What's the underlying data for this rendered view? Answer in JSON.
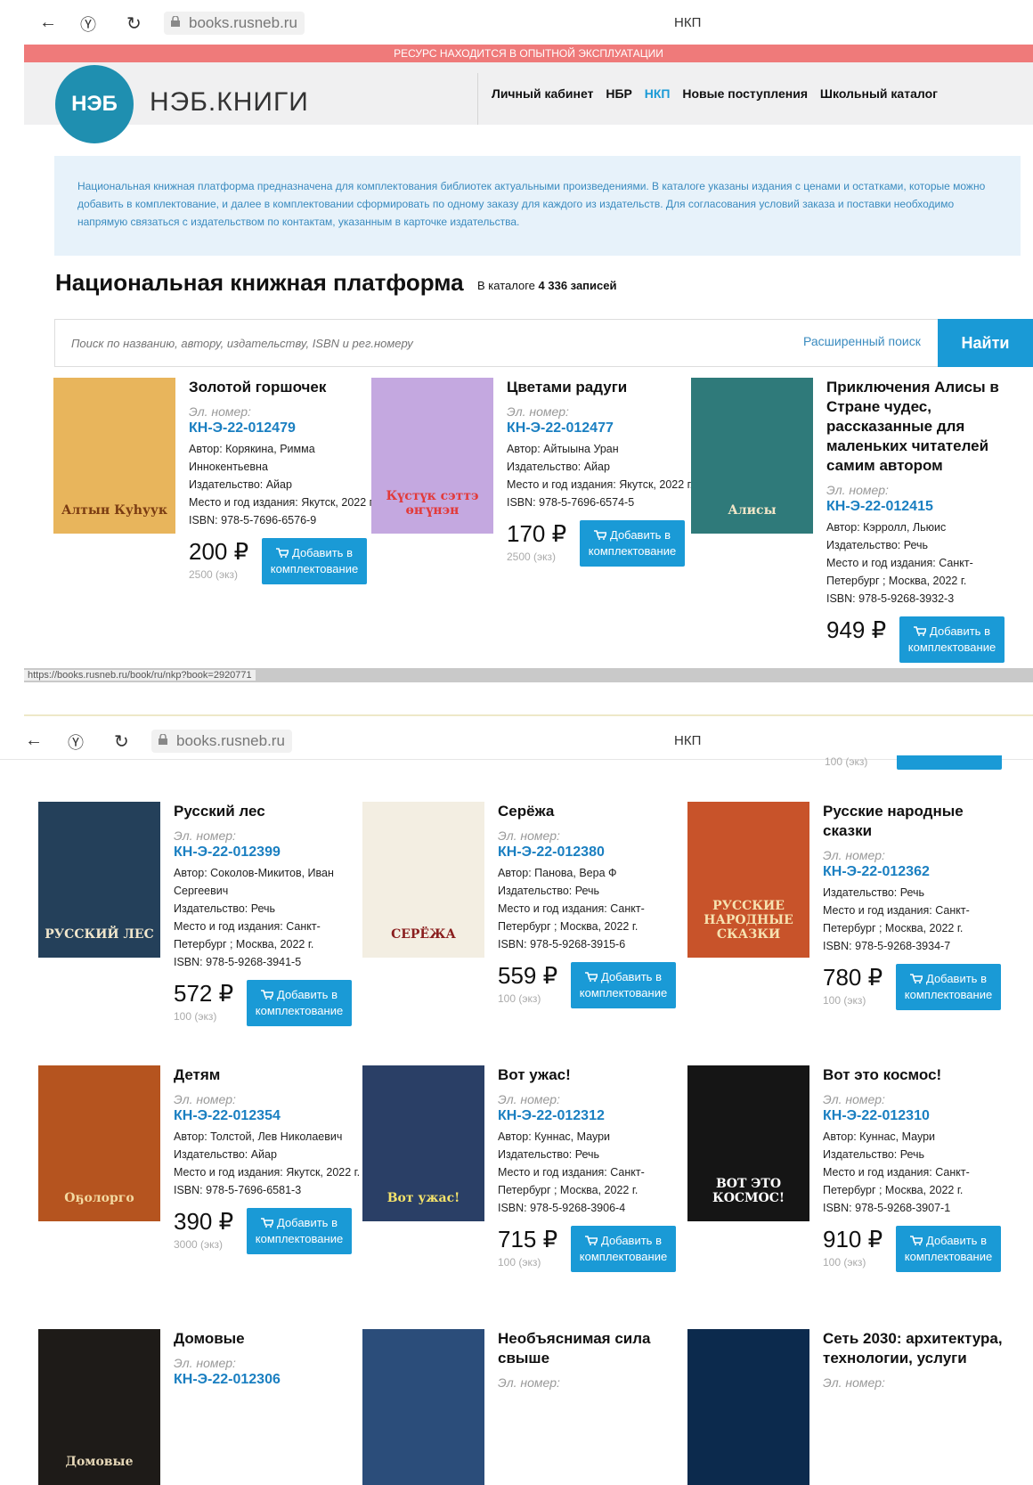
{
  "browser1": {
    "url": "books.rusneb.ru",
    "page_title": "НКП"
  },
  "browser2": {
    "url": "books.rusneb.ru",
    "page_title": "НКП"
  },
  "banner": "РЕСУРС НАХОДИТСЯ В ОПЫТНОЙ ЭКСПЛУАТАЦИИ",
  "logo": {
    "mark": "НЭБ",
    "name": "НЭБ.КНИГИ"
  },
  "menu": [
    "Личный кабинет",
    "НБР",
    "НКП",
    "Новые поступления",
    "Школьный каталог"
  ],
  "info": "Национальная книжная платформа предназначена для комплектования библиотек актуальными произведениями. В каталоге указаны издания с ценами и остатками, которые можно добавить в комплектование, и далее в комплектовании сформировать по одному заказу для каждого из издательств. Для согласования условий заказа и поставки необходимо напрямую связаться с издательством по контактам, указанным в карточке издательства.",
  "heading": "Национальная книжная платформа",
  "count_prefix": "В каталоге",
  "count_value": "4 336 записей",
  "search": {
    "placeholder": "Поиск по названию, автору, издательству, ISBN и рег.номеру",
    "advanced": "Расширенный поиск",
    "button": "Найти"
  },
  "status_url": "https://books.rusneb.ru/book/ru/nkp?book=2920771",
  "scroll_tail": {
    "qty": "100 (экз)"
  },
  "el_label": "Эл. номер:",
  "add_label": "Добавить в комплектование",
  "books": [
    {
      "title": "Золотой горшочек",
      "code": "КН-Э-22-012479",
      "meta": [
        "Автор: Корякина, Римма Иннокентьевна",
        "Издательство: Айар",
        "Место и год издания: Якутск, 2022 г.",
        "ISBN: 978-5-7696-6576-9"
      ],
      "price": "200 ₽",
      "qty": "2500 (экз)"
    },
    {
      "title": "Цветами радуги",
      "code": "КН-Э-22-012477",
      "meta": [
        "Автор: Айтыына Уран",
        "Издательство: Айар",
        "Место и год издания: Якутск, 2022 г.",
        "ISBN: 978-5-7696-6574-5"
      ],
      "price": "170 ₽",
      "qty": "2500 (экз)"
    },
    {
      "title": "Приключения Алисы в Стране чудес, рассказанные для маленьких читателей самим автором",
      "code": "КН-Э-22-012415",
      "meta": [
        "Автор: Кэрролл, Льюис",
        "Издательство: Речь",
        "Место и год издания: Санкт-Петербург ; Москва, 2022 г.",
        "ISBN: 978-5-9268-3932-3"
      ],
      "price": "949 ₽",
      "qty": ""
    },
    {
      "title": "Русский лес",
      "code": "КН-Э-22-012399",
      "meta": [
        "Автор: Соколов-Микитов, Иван Сергеевич",
        "Издательство: Речь",
        "Место и год издания: Санкт-Петербург ; Москва, 2022 г.",
        "ISBN: 978-5-9268-3941-5"
      ],
      "price": "572 ₽",
      "qty": "100 (экз)"
    },
    {
      "title": "Серёжа",
      "code": "КН-Э-22-012380",
      "meta": [
        "Автор: Панова, Вера Ф",
        "Издательство: Речь",
        "Место и год издания: Санкт-Петербург ; Москва, 2022 г.",
        "ISBN: 978-5-9268-3915-6"
      ],
      "price": "559 ₽",
      "qty": "100 (экз)"
    },
    {
      "title": "Русские народные сказки",
      "code": "КН-Э-22-012362",
      "meta": [
        "Издательство: Речь",
        "Место и год издания: Санкт-Петербург ; Москва, 2022 г.",
        "ISBN: 978-5-9268-3934-7"
      ],
      "price": "780 ₽",
      "qty": "100 (экз)"
    },
    {
      "title": "Детям",
      "code": "КН-Э-22-012354",
      "meta": [
        "Автор: Толстой, Лев Николаевич",
        "Издательство: Айар",
        "Место и год издания: Якутск, 2022 г.",
        "ISBN: 978-5-7696-6581-3"
      ],
      "price": "390 ₽",
      "qty": "3000 (экз)"
    },
    {
      "title": "Вот ужас!",
      "code": "КН-Э-22-012312",
      "meta": [
        "Автор: Куннас, Маури",
        "Издательство: Речь",
        "Место и год издания: Санкт-Петербург ; Москва, 2022 г.",
        "ISBN: 978-5-9268-3906-4"
      ],
      "price": "715 ₽",
      "qty": "100 (экз)"
    },
    {
      "title": "Вот это космос!",
      "code": "КН-Э-22-012310",
      "meta": [
        "Автор: Куннас, Маури",
        "Издательство: Речь",
        "Место и год издания: Санкт-Петербург ; Москва, 2022 г.",
        "ISBN: 978-5-9268-3907-1"
      ],
      "price": "910 ₽",
      "qty": "100 (экз)"
    },
    {
      "title": "Домовые",
      "code": "КН-Э-22-012306",
      "meta": [],
      "price": "",
      "qty": ""
    },
    {
      "title": "Необъяснимая сила свыше",
      "code": "",
      "meta": [],
      "price": "",
      "qty": ""
    },
    {
      "title": "Сеть 2030: архитектура, технологии, услуги",
      "code": "",
      "meta": [],
      "price": "",
      "qty": ""
    }
  ],
  "covers": [
    {
      "label": "Алтын Куһуук",
      "bg": "#e8b55c",
      "fg": "#7a3b12"
    },
    {
      "label": "Күстүк сэттэ өҥүнэн",
      "bg": "#c4a8e0",
      "fg": "#e23a3a"
    },
    {
      "label": "Алисы",
      "bg": "#2f7a7a",
      "fg": "#f2e6c8"
    },
    {
      "label": "РУССКИЙ ЛЕС",
      "bg": "#24405a",
      "fg": "#f0e6cc"
    },
    {
      "label": "СЕРЁЖА",
      "bg": "#f3eee2",
      "fg": "#8a1e1e"
    },
    {
      "label": "РУССКИЕ НАРОДНЫЕ СКАЗКИ",
      "bg": "#c8532a",
      "fg": "#f6e2b0"
    },
    {
      "label": "Оҕолорго",
      "bg": "#b5541f",
      "fg": "#f3d9a0"
    },
    {
      "label": "Вот ужас!",
      "bg": "#2a3f66",
      "fg": "#f5e36a"
    },
    {
      "label": "ВОТ ЭТО КОСМОС!",
      "bg": "#151515",
      "fg": "#ffffff"
    },
    {
      "label": "Домовые",
      "bg": "#1e1b18",
      "fg": "#e7d8b8"
    },
    {
      "label": "",
      "bg": "#2b4d7a",
      "fg": "#ffffff"
    },
    {
      "label": "",
      "bg": "#0c2a4d",
      "fg": "#ffffff"
    }
  ]
}
